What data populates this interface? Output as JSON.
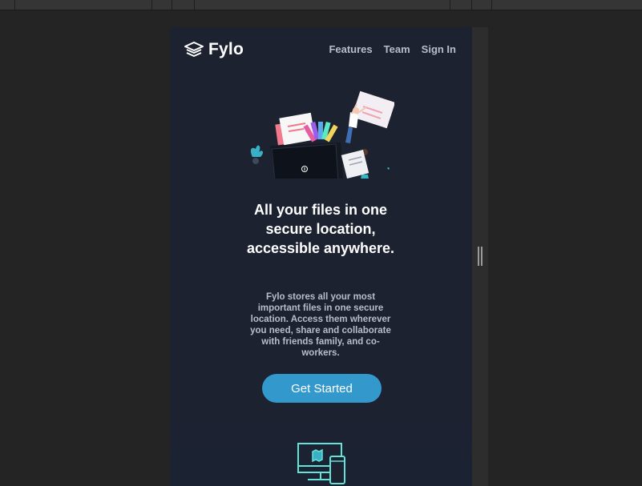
{
  "colors": {
    "background": "#1c2230",
    "accent": "#3399cc",
    "text_primary": "#ffffff",
    "text_secondary": "#b7bdc9",
    "icon_teal": "#65e2d9"
  },
  "header": {
    "logo": {
      "text": "Fylo",
      "icon": "layers-logo-icon"
    },
    "nav": [
      {
        "label": "Features"
      },
      {
        "label": "Team"
      },
      {
        "label": "Sign In"
      }
    ]
  },
  "hero": {
    "illustration": "intro-illustration",
    "headline": "All your files in one secure location, accessible anywhere.",
    "description": "Fylo stores all your most important files in one secure location. Access them wherever you need, share and collaborate with friends family, and co-workers.",
    "cta_label": "Get Started"
  },
  "features": {
    "icon": "access-anywhere-icon"
  }
}
